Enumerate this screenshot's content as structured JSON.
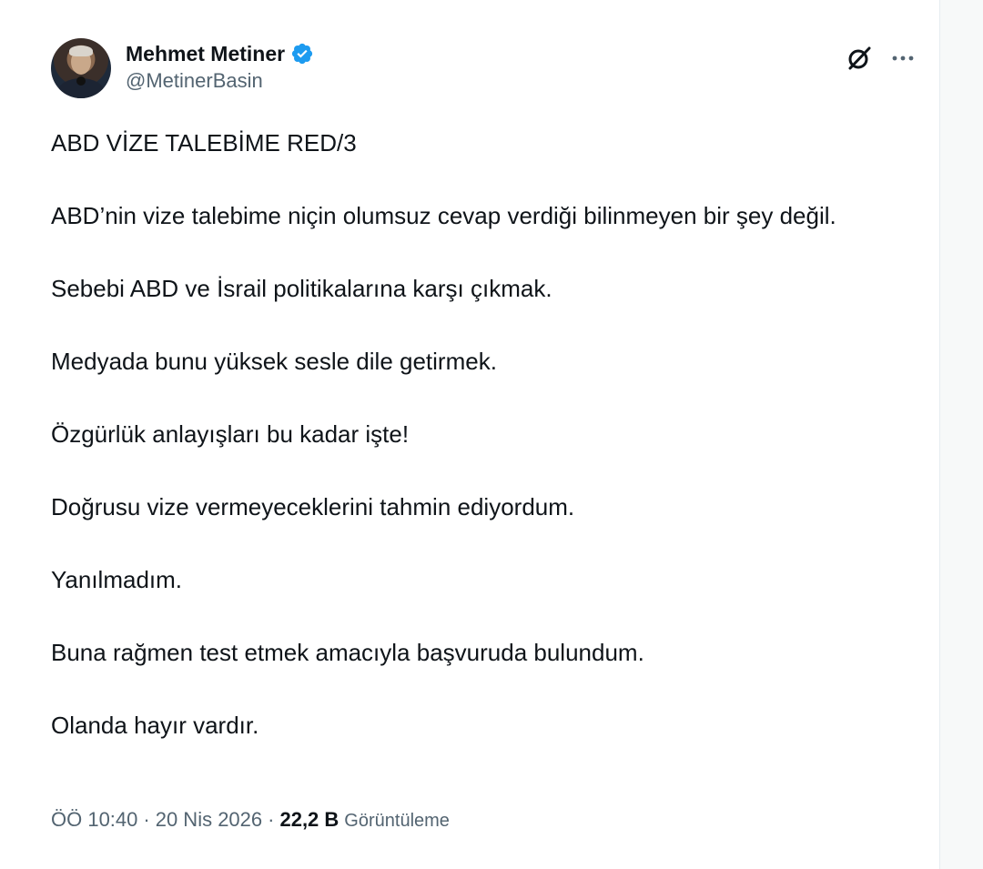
{
  "author": {
    "display_name": "Mehmet Metiner",
    "handle": "@MetinerBasin",
    "verified": true,
    "verified_color": "#1d9bf0"
  },
  "icons": {
    "avatar": "profile-photo",
    "verified": "verified-badge-icon",
    "grok": "grok-icon",
    "more": "more-icon"
  },
  "tweet": {
    "paragraphs": [
      "ABD VİZE TALEBİME RED/3",
      "ABD’nin vize talebime niçin olumsuz cevap verdiği bilinmeyen bir şey değil.",
      "Sebebi ABD ve İsrail politikalarına karşı çıkmak.",
      "Medyada bunu yüksek sesle dile getirmek.",
      "Özgürlük anlayışları bu kadar işte!",
      "Doğrusu vize vermeyeceklerini tahmin ediyordum.",
      "Yanılmadım.",
      "Buna rağmen test etmek amacıyla başvuruda bulundum.",
      "Olanda hayır vardır."
    ]
  },
  "meta": {
    "time": "ÖÖ 10:40",
    "separator": "·",
    "date": "20 Nis 2026",
    "views_count": "22,2 B",
    "views_label": "Görüntüleme"
  },
  "colors": {
    "text_primary": "#0f1419",
    "text_secondary": "#536471",
    "background": "#ffffff"
  }
}
